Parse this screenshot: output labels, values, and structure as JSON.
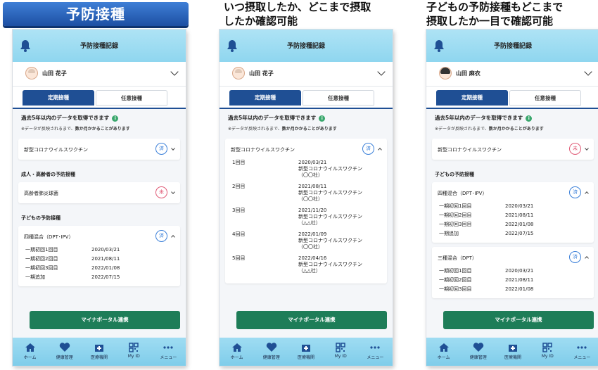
{
  "badge": "予防接種",
  "captions": {
    "middle": [
      "いつ摂取したか、どこまで摂取",
      "したか確認可能"
    ],
    "right": [
      "子どもの予防接種もどこまで",
      "摂取したか一目で確認可能"
    ]
  },
  "app": {
    "title": "予防接種記録",
    "tab_routine": "定期接種",
    "tab_optional": "任意接種",
    "notice_title": "過去5年以内のデータを取得できます",
    "notice_info_icon": "i",
    "notice_sub_prefix": "※データが反映されるまで、",
    "notice_sub_bold": "数か月かかることがあります",
    "cta": "マイナポータル連携",
    "status_done": "済",
    "status_not": "未",
    "nav": [
      {
        "label": "ホーム",
        "icon": "home-icon"
      },
      {
        "label": "健康管理",
        "icon": "heart-icon"
      },
      {
        "label": "医療機関",
        "icon": "hospital-icon"
      },
      {
        "label": "My ID",
        "icon": "qr-icon"
      },
      {
        "label": "メニュー",
        "icon": "more-icon"
      }
    ],
    "colors": {
      "primary": "#1f4f94",
      "cta": "#1e7d58",
      "done": "#3b80d9",
      "not": "#e05a76",
      "header": "#8fd6ef"
    }
  },
  "phone1": {
    "user": "山田 花子",
    "covid": "新型コロナウイルスワクチン",
    "section_adult": "成人・高齢者の予防接種",
    "adult_item": "高齢者肺炎球菌",
    "section_child": "子どもの予防接種",
    "child_item": "四種混合（DPT･IPV）",
    "doses": [
      {
        "label": "一期初回1回目",
        "date": "2020/03/21"
      },
      {
        "label": "一期初回2回目",
        "date": "2021/08/11"
      },
      {
        "label": "一期初回3回目",
        "date": "2022/01/08"
      },
      {
        "label": "一期追加",
        "date": "2022/07/15"
      }
    ]
  },
  "phone2": {
    "user": "山田 花子",
    "covid": "新型コロナウイルスワクチン",
    "doses": [
      {
        "label": "1回目",
        "date": "2020/03/21",
        "name": "新型コロナウイルスワクチン",
        "maker": "（〇〇社）"
      },
      {
        "label": "2回目",
        "date": "2021/08/11",
        "name": "新型コロナウイルスワクチン",
        "maker": "（〇〇社）"
      },
      {
        "label": "3回目",
        "date": "2021/11/20",
        "name": "新型コロナウイルスワクチン",
        "maker": "（△△社）"
      },
      {
        "label": "4回目",
        "date": "2022/01/09",
        "name": "新型コロナウイルスワクチン",
        "maker": "（〇〇社）"
      },
      {
        "label": "5回目",
        "date": "2022/04/16",
        "name": "新型コロナウイルスワクチン",
        "maker": "（△△社）"
      }
    ]
  },
  "phone3": {
    "user": "山田 麻衣",
    "covid": "新型コロナウイルスワクチン",
    "section_child": "子どもの予防接種",
    "item1": "四種混合（DPT･IPV）",
    "doses1": [
      {
        "label": "一期初回1回目",
        "date": "2020/03/21"
      },
      {
        "label": "一期初回2回目",
        "date": "2021/08/11"
      },
      {
        "label": "一期初回3回目",
        "date": "2022/01/08"
      },
      {
        "label": "一期追加",
        "date": "2022/07/15"
      }
    ],
    "item2": "三種混合（DPT）",
    "doses2": [
      {
        "label": "一期初回1回目",
        "date": "2020/03/21"
      },
      {
        "label": "一期初回2回目",
        "date": "2021/08/11"
      },
      {
        "label": "一期初回3回目",
        "date": "2022/01/08"
      }
    ]
  }
}
